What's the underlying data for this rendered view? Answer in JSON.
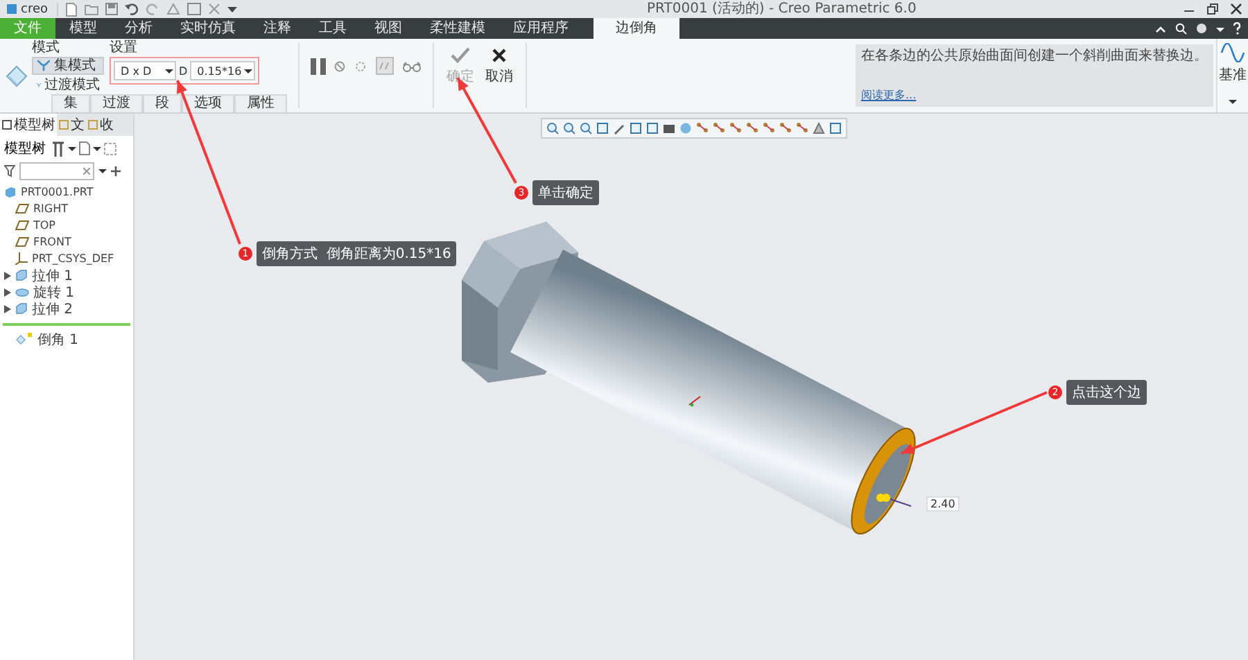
{
  "window": {
    "logo": "creo",
    "title": "PRT0001 (活动的) - Creo Parametric 6.0"
  },
  "menu_tabs": [
    {
      "label": "文件",
      "kind": "file",
      "selected": false
    },
    {
      "label": "模型",
      "kind": "tab",
      "selected": false
    },
    {
      "label": "分析",
      "kind": "tab",
      "selected": false
    },
    {
      "label": "实时仿真",
      "kind": "tab",
      "selected": false
    },
    {
      "label": "注释",
      "kind": "tab",
      "selected": false
    },
    {
      "label": "工具",
      "kind": "tab",
      "selected": false
    },
    {
      "label": "视图",
      "kind": "tab",
      "selected": false
    },
    {
      "label": "柔性建模",
      "kind": "tab",
      "selected": false
    },
    {
      "label": "应用程序",
      "kind": "tab",
      "selected": false
    },
    {
      "label": "边倒角",
      "kind": "tab",
      "selected": true
    }
  ],
  "ribbon": {
    "mode": {
      "title": "模式",
      "buttons": [
        {
          "label": "集模式",
          "selected": true
        },
        {
          "label": "过渡模式",
          "selected": false
        }
      ]
    },
    "settings": {
      "title": "设置",
      "scheme": "D x D",
      "dimension_label": "D",
      "dimension_value": "0.15*16"
    },
    "panel_tabs": [
      {
        "label": "集"
      },
      {
        "label": "过渡"
      },
      {
        "label": "段"
      },
      {
        "label": "选项"
      },
      {
        "label": "属性"
      }
    ],
    "actions": [
      {
        "kind": "ok",
        "label": "确定",
        "disabled": true
      },
      {
        "kind": "cancel",
        "label": "取消",
        "disabled": false
      }
    ],
    "help": {
      "text": "在各条边的公共原始曲面间创建一个斜削曲面来替换边。",
      "link": "阅读更多..."
    },
    "datum": {
      "label": "基准"
    }
  },
  "left_panel": {
    "tabs": [
      {
        "label": "模型树",
        "selected": true
      },
      {
        "label": "文",
        "selected": false
      },
      {
        "label": "收",
        "selected": false
      }
    ],
    "toolbar_label": "模型树",
    "tree": [
      {
        "label": "PRT0001.PRT",
        "kind": "part"
      },
      {
        "label": "RIGHT",
        "kind": "plane"
      },
      {
        "label": "TOP",
        "kind": "plane"
      },
      {
        "label": "FRONT",
        "kind": "plane"
      },
      {
        "label": "PRT_CSYS_DEF",
        "kind": "csys"
      },
      {
        "label": "拉伸 1",
        "kind": "extrude",
        "expanded": false
      },
      {
        "label": "旋转 1",
        "kind": "revolve",
        "expanded": false
      },
      {
        "label": "拉伸 2",
        "kind": "extrude",
        "expanded": false
      },
      {
        "label": "倒角 1",
        "kind": "chamfer",
        "inserting": true
      }
    ]
  },
  "canvas": {
    "callouts": [
      {
        "number": "1",
        "text": "倒角方式  倒角距离为0.15*16"
      },
      {
        "number": "2",
        "text": "点击这个边"
      },
      {
        "number": "3",
        "text": "单击确定"
      }
    ],
    "dimension": "2.40"
  }
}
